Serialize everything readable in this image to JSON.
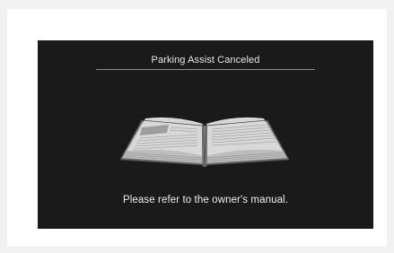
{
  "dialog": {
    "title": "Parking Assist Canceled",
    "message": "Please refer to the owner's manual."
  },
  "icons": {
    "book": "open-book-icon"
  },
  "colors": {
    "screen_background": "#1a1a1a",
    "text": "#e6e6e6",
    "divider": "#8a8a8a",
    "page_background": "#f1f1f1"
  }
}
